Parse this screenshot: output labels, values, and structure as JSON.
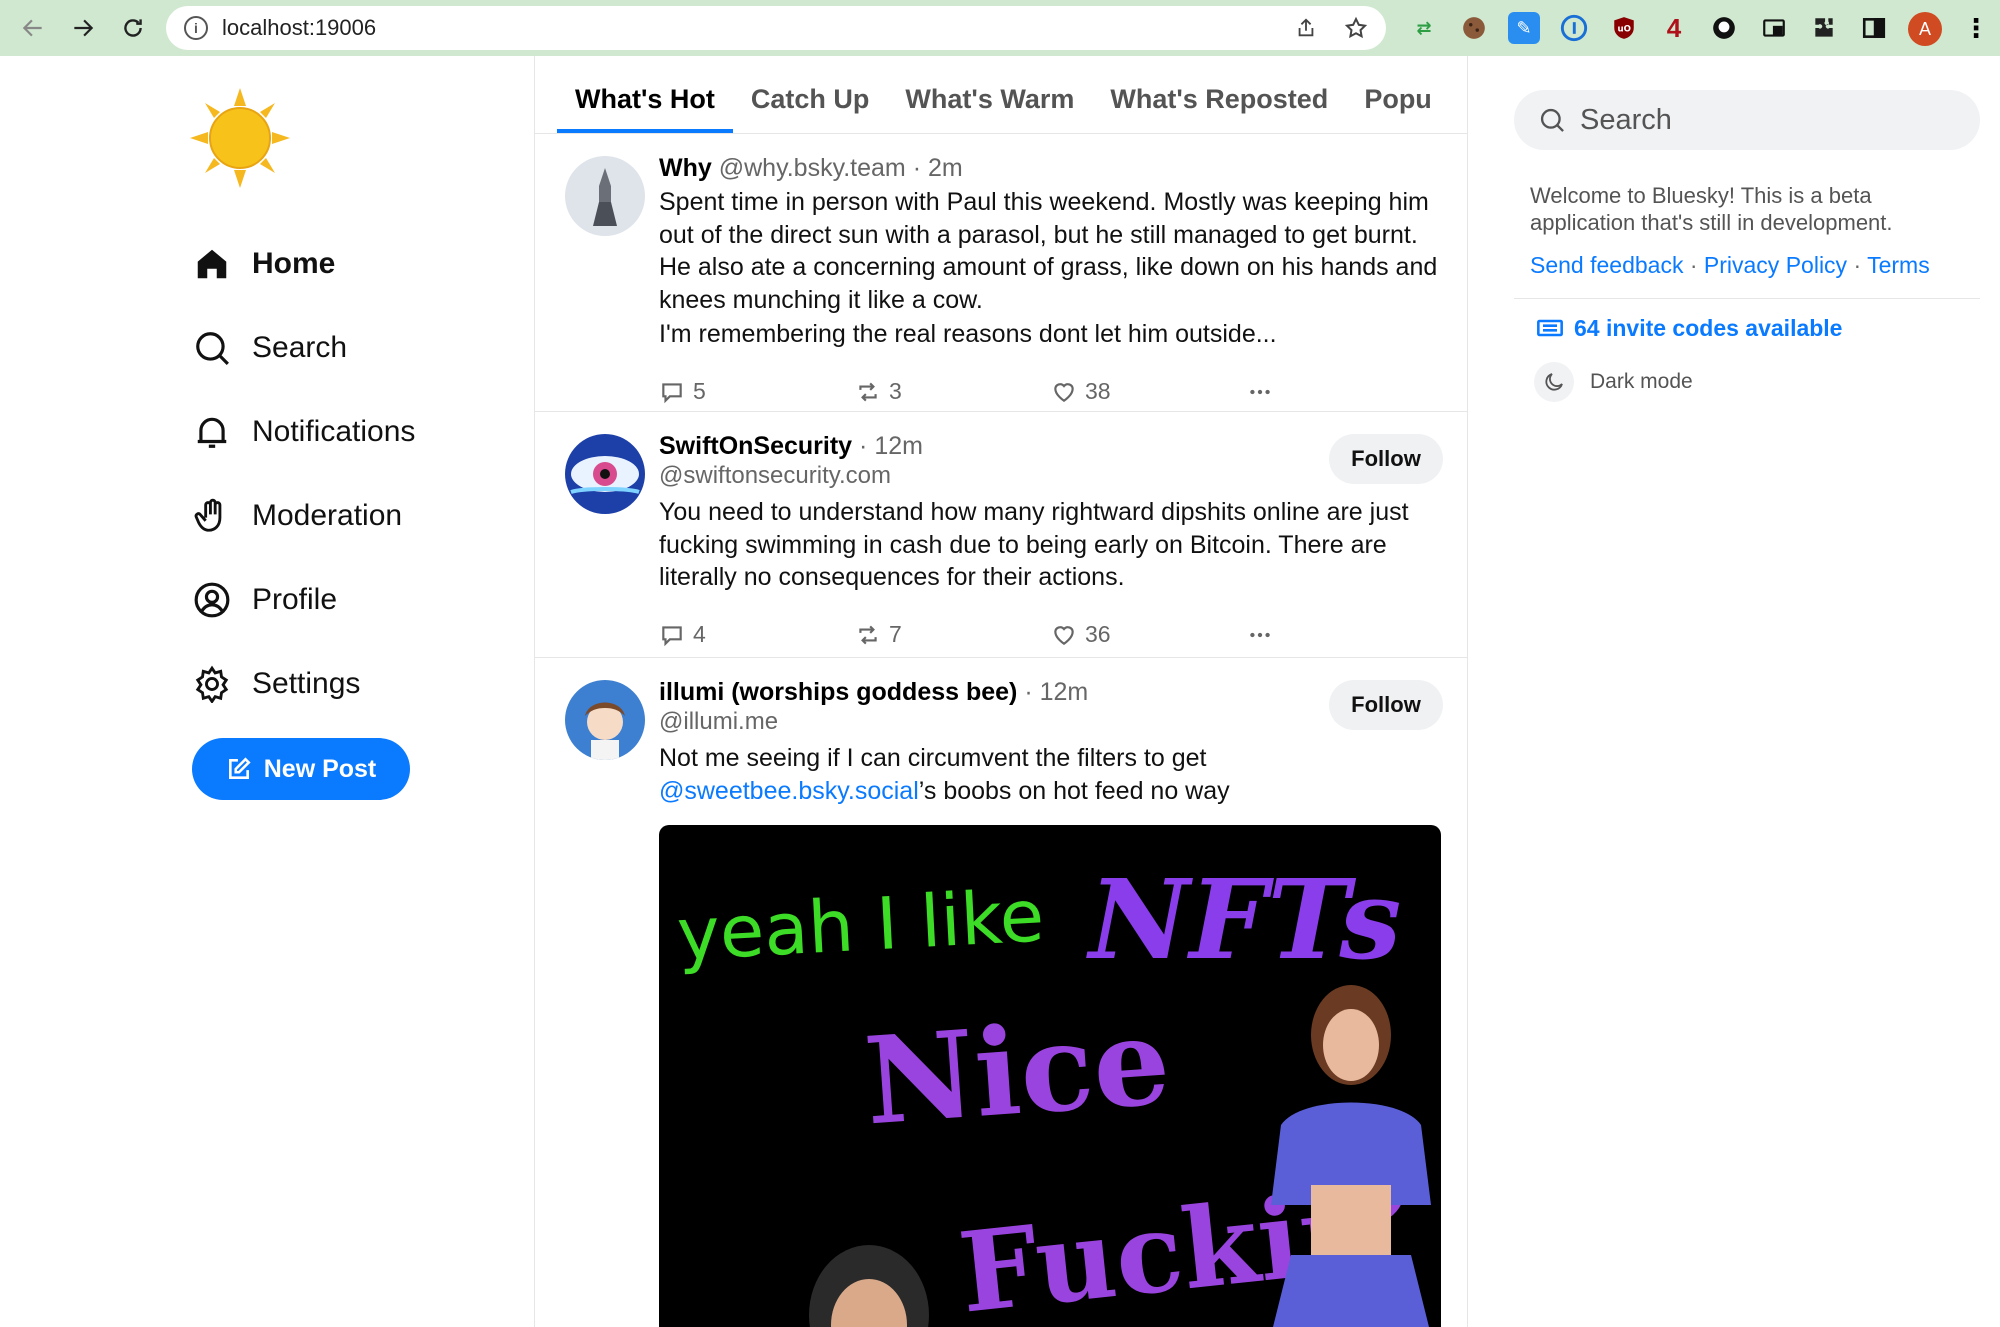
{
  "browser": {
    "url": "localhost:19006",
    "extensions": [
      "translate-icon",
      "cookie-icon",
      "bookmark-icon",
      "1password-icon",
      "ublock-icon",
      "4-icon",
      "github-icon",
      "pip-icon",
      "puzzle-icon",
      "sidebar-icon"
    ],
    "profile_initial": "A",
    "ext_label_4": "4"
  },
  "sidebar": {
    "items": [
      {
        "label": "Home",
        "icon": "home-icon",
        "active": true
      },
      {
        "label": "Search",
        "icon": "search-icon"
      },
      {
        "label": "Notifications",
        "icon": "bell-icon"
      },
      {
        "label": "Moderation",
        "icon": "hand-icon"
      },
      {
        "label": "Profile",
        "icon": "user-circle-icon"
      },
      {
        "label": "Settings",
        "icon": "gear-icon"
      }
    ],
    "new_post_label": "New Post"
  },
  "tabs": [
    {
      "label": "What's Hot",
      "active": true
    },
    {
      "label": "Catch Up"
    },
    {
      "label": "What's Warm"
    },
    {
      "label": "What's Reposted"
    },
    {
      "label": "Popu"
    }
  ],
  "posts": [
    {
      "name": "Why",
      "handle": "@why.bsky.team",
      "time": "2m",
      "text": "Spent time in person with Paul this weekend. Mostly was keeping him out of the direct sun with a parasol, but he still managed to get burnt. He also ate a concerning amount of grass, like down on his hands and knees munching it like a cow.",
      "text2": "I'm remembering the real reasons dont let him outside...",
      "replies": "5",
      "reposts": "3",
      "likes": "38"
    },
    {
      "name": "SwiftOnSecurity",
      "handle": "@swiftonsecurity.com",
      "time": "12m",
      "follow_label": "Follow",
      "text": "You need to understand how many rightward dipshits online are just fucking swimming in cash due to being early on Bitcoin. There are literally no consequences for their actions.",
      "replies": "4",
      "reposts": "7",
      "likes": "36"
    },
    {
      "name": "illumi (worships goddess bee)",
      "handle": "@illumi.me",
      "time": "12m",
      "follow_label": "Follow",
      "text_before": "Not me seeing if I can circumvent the filters to get ",
      "mention": "@sweetbee.bsky.social",
      "text_after": "’s boobs on hot feed no way",
      "image_text": {
        "line1": "yeah I like",
        "line2": "NFTs",
        "line3": "Nice",
        "line4": "Fuckin’"
      }
    }
  ],
  "right": {
    "search_placeholder": "Search",
    "welcome": "Welcome to Bluesky! This is a beta application that's still in development.",
    "links": [
      "Send feedback",
      "Privacy Policy",
      "Terms"
    ],
    "link_sep": "·",
    "invites": "64 invite codes available",
    "dark_mode": "Dark mode"
  },
  "colors": {
    "accent": "#0a7aff",
    "chrome_bg": "#cfe8cf",
    "meme_green": "#3ddc27",
    "meme_purple": "#8a3dea"
  }
}
